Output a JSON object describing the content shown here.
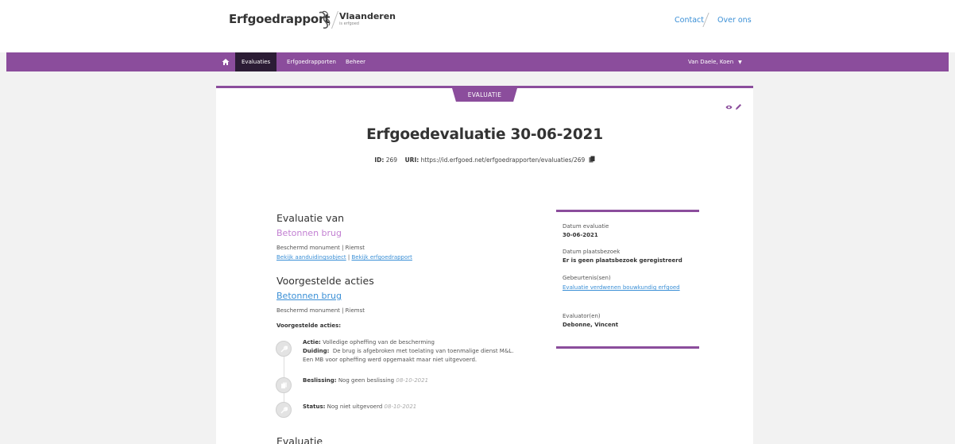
{
  "header": {
    "brand": "Erfgoedrapport",
    "logo_title": "Vlaanderen",
    "logo_sub": "is erfgoed",
    "links": {
      "contact": "Contact",
      "about": "Over ons"
    }
  },
  "nav": {
    "items": [
      {
        "label": "Evaluaties",
        "active": true
      },
      {
        "label": "Erfgoedrapporten",
        "active": false
      },
      {
        "label": "Beheer",
        "active": false
      }
    ],
    "user": "Van Daele, Koen"
  },
  "card": {
    "badge": "EVALUATIE",
    "title": "Erfgoedevaluatie 30-06-2021",
    "id_label": "ID:",
    "id_value": "269",
    "uri_label": "URI:",
    "uri_value": "https://id.erfgoed.net/erfgoedrapporten/evaluaties/269"
  },
  "evaluatie_van": {
    "heading": "Evaluatie van",
    "object_name": "Betonnen brug",
    "meta": "Beschermd monument | Riemst",
    "link1": "Bekijk aanduidingsobject",
    "separator": " | ",
    "link2": "Bekijk erfgoedrapport"
  },
  "voorgestelde": {
    "heading": "Voorgestelde acties",
    "object_name": "Betonnen brug",
    "meta": "Beschermd monument | Riemst",
    "subheading": "Voorgestelde acties:",
    "actie_label": "Actie:",
    "actie_value": "Volledige opheffing van de bescherming",
    "duiding_label": "Duiding:",
    "duiding_line1": "De brug is afgebroken met toelating van toenmalige dienst M&L.",
    "duiding_line2": "Een MB voor opheffing werd opgemaakt maar niet uitgevoerd.",
    "beslissing_label": "Beslissing:",
    "beslissing_value": "Nog geen beslissing",
    "beslissing_date": "08-10-2021",
    "status_label": "Status:",
    "status_value": "Nog niet uitgevoerd",
    "status_date": "08-10-2021"
  },
  "evaluatie_heading": "Evaluatie",
  "side": {
    "datum_label": "Datum evaluatie",
    "datum_value": "30-06-2021",
    "plaatsbezoek_label": "Datum plaatsbezoek",
    "plaatsbezoek_value": "Er is geen plaatsbezoek geregistreerd",
    "gebeurtenis_label": "Gebeurtenis(sen)",
    "gebeurtenis_value": "Evaluatie verdwenen bouwkundig erfgoed",
    "evaluator_label": "Evaluator(en)",
    "evaluator_value": "Debonne, Vincent"
  },
  "colors": {
    "accent": "#8b4d9c",
    "nav_active": "#2c1c35",
    "link": "#3a8fd6",
    "object_link": "#c27fd2"
  }
}
